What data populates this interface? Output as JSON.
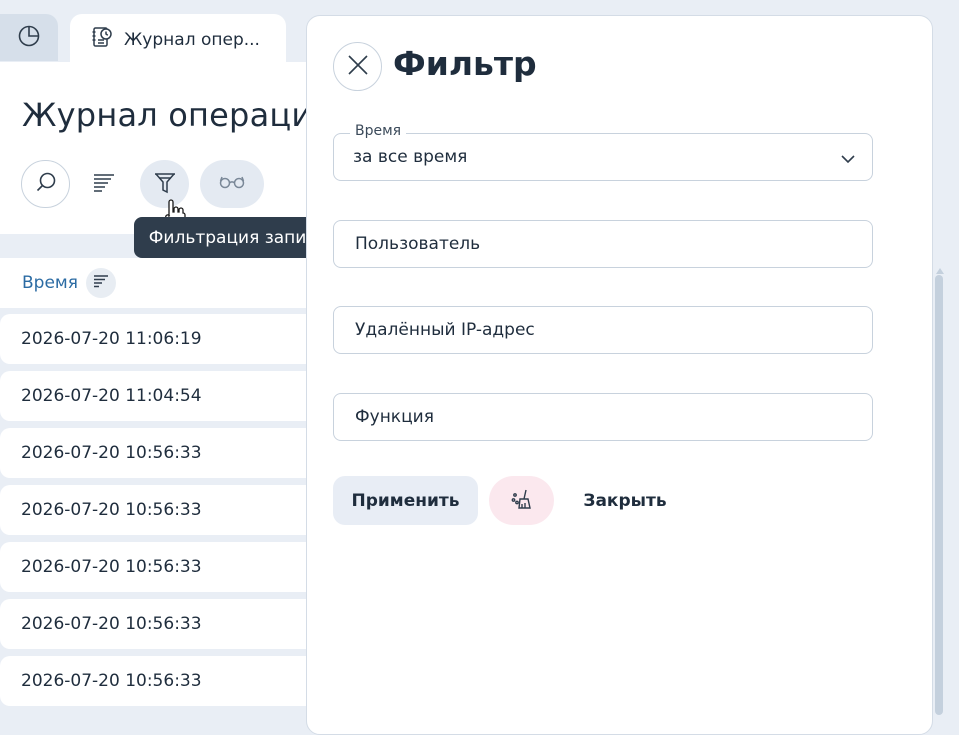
{
  "tabs": [
    {
      "icon": "pie-chart-icon",
      "label": ""
    },
    {
      "icon": "journal-clock-icon",
      "label": "Журнал опер..."
    }
  ],
  "page": {
    "title": "Журнал операций"
  },
  "toolbar": {
    "search_icon": "search-icon",
    "sort_icon": "sort-lines-icon",
    "filter_icon": "filter-icon",
    "view_icon": "glasses-icon",
    "tooltip": "Фильтрация записей"
  },
  "table": {
    "column_time": "Время",
    "rows": [
      "2026-07-20 11:06:19",
      "2026-07-20 11:04:54",
      "2026-07-20 10:56:33",
      "2026-07-20 10:56:33",
      "2026-07-20 10:56:33",
      "2026-07-20 10:56:33",
      "2026-07-20 10:56:33"
    ]
  },
  "filter": {
    "title": "Фильтр",
    "time_label": "Время",
    "time_value": "за все время",
    "user_placeholder": "Пользователь",
    "ip_placeholder": "Удалённый IP-адрес",
    "function_placeholder": "Функция",
    "apply_label": "Применить",
    "close_label": "Закрыть"
  },
  "colors": {
    "accent_link": "#2b6ba3",
    "tooltip_bg": "#2f3d4c",
    "clear_btn_bg": "#fbe8ee"
  }
}
